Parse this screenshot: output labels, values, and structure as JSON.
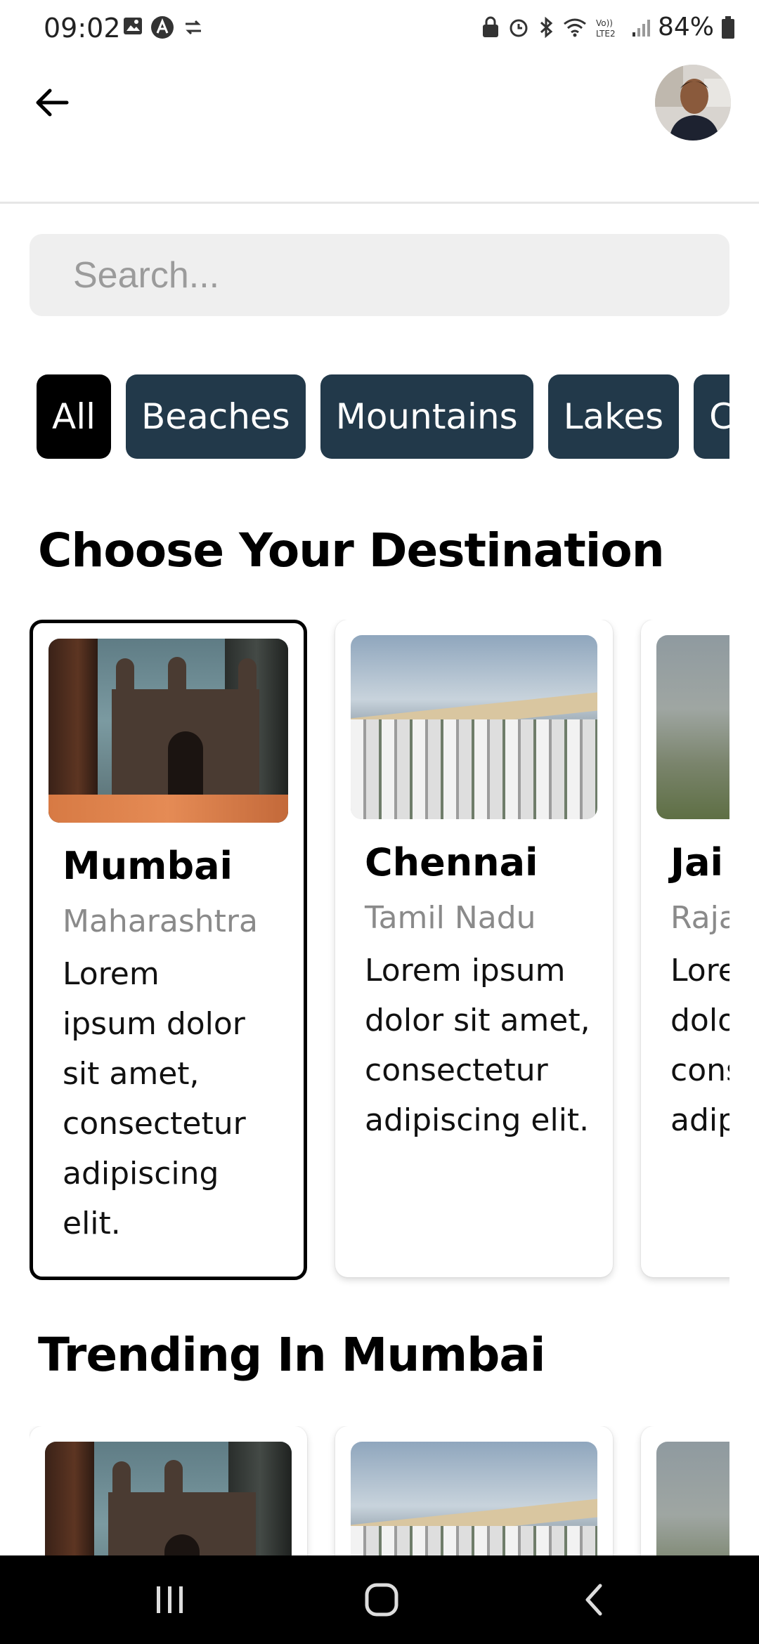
{
  "status_bar": {
    "time": "09:02",
    "battery_percent": "84%"
  },
  "search": {
    "placeholder": "Search..."
  },
  "categories": [
    "All",
    "Beaches",
    "Mountains",
    "Lakes",
    "C"
  ],
  "active_category": "All",
  "sections": {
    "destinations_title": "Choose Your Destination",
    "trending_title": "Trending In Mumbai"
  },
  "destinations": [
    {
      "name": "Mumbai",
      "state": "Maharashtra",
      "description": "Lorem ipsum dolor sit amet, consectetur adipiscing elit."
    },
    {
      "name": "Chennai",
      "state": "Tamil Nadu",
      "description": "Lorem ipsum dolor sit amet, consectetur adipiscing elit."
    },
    {
      "name": "Jai",
      "state": "Raja",
      "description": "Lore dolo cons adip"
    }
  ],
  "colors": {
    "chip_bg": "#22394a",
    "chip_active_bg": "#000000",
    "search_bg": "#efefef",
    "nav_bg": "#000000"
  },
  "icons": {
    "back": "arrow-left-icon",
    "nav_recents": "recents-icon",
    "nav_home": "home-icon",
    "nav_back": "chevron-left-icon"
  }
}
